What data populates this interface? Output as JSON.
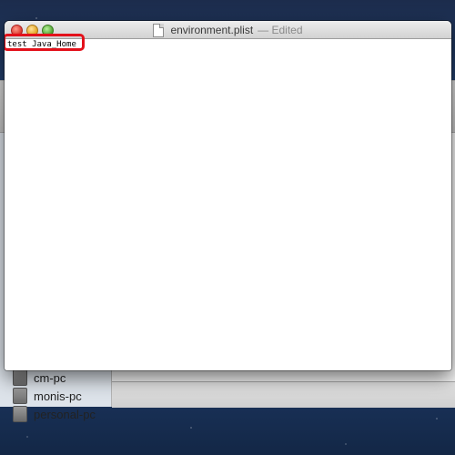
{
  "window": {
    "filename": "environment.plist",
    "status": "— Edited",
    "document_text": "test Java_Home"
  },
  "background_finder": {
    "sidebar_items": [
      {
        "label": "cm-pc"
      },
      {
        "label": "monis-pc"
      },
      {
        "label": "personal-pc"
      }
    ]
  },
  "colors": {
    "highlight": "#e3111b",
    "close": "#d8352a",
    "minimize": "#e2a21f",
    "zoom": "#4ea02e"
  }
}
